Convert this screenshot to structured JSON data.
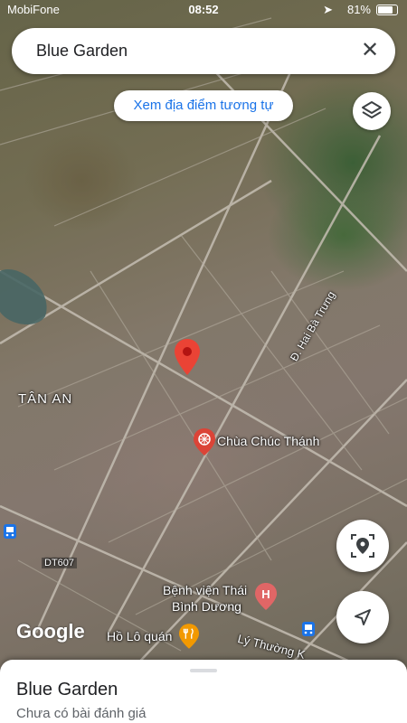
{
  "status_bar": {
    "carrier": "MobiFone",
    "time": "08:52",
    "battery": "81%"
  },
  "search": {
    "query": "Blue Garden",
    "close_icon": "close-icon"
  },
  "chip": {
    "label": "Xem địa điểm tương tự"
  },
  "map": {
    "area_label": "TÂN AN",
    "street_label": "Đ. Hai Bà Trưng",
    "pois": [
      {
        "name": "Chùa Chúc Thánh",
        "icon": "temple-icon",
        "color": "#db4437"
      },
      {
        "name_line1": "Bệnh viện Thái",
        "name_line2": "Bình Dương",
        "icon": "hospital-icon",
        "color": "#e06666"
      },
      {
        "name": "Hồ Lô quán",
        "icon": "restaurant-icon",
        "color": "#f29900"
      }
    ],
    "road_labels": [
      "DT607",
      "Lý Thường K"
    ],
    "attribution": "Google"
  },
  "buttons": {
    "layers_icon": "layers-icon",
    "locate_icon": "place-icon",
    "my_location_icon": "navigation-icon"
  },
  "place_sheet": {
    "title": "Blue Garden",
    "subtitle": "Chưa có bài đánh giá"
  }
}
